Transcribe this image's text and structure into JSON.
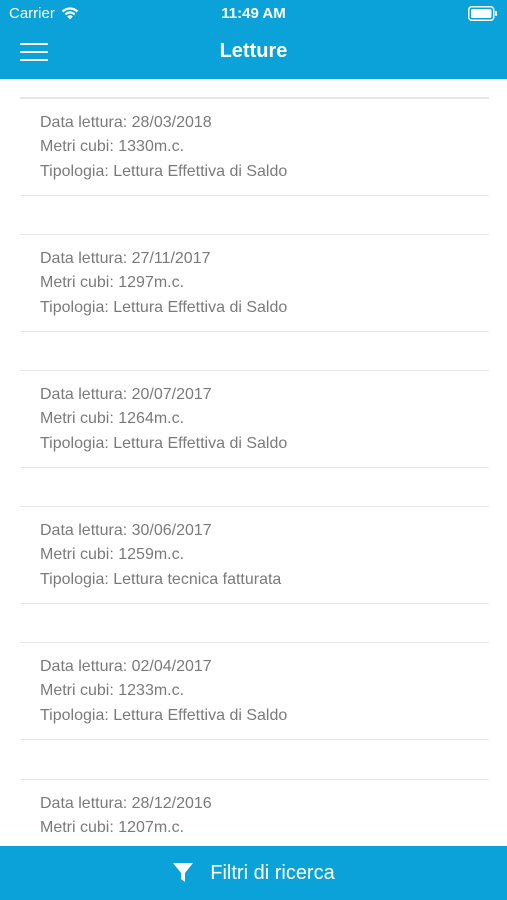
{
  "status_bar": {
    "carrier": "Carrier",
    "time": "11:49 AM"
  },
  "nav": {
    "title": "Letture",
    "menu_icon": "hamburger-menu-icon"
  },
  "readings": [
    {
      "date_label": "Data lettura: 28/03/2018",
      "volume_label": "Metri cubi: 1330m.c.",
      "type_label": "Tipologia: Lettura Effettiva di Saldo"
    },
    {
      "date_label": "Data lettura: 27/11/2017",
      "volume_label": "Metri cubi: 1297m.c.",
      "type_label": "Tipologia: Lettura Effettiva di Saldo"
    },
    {
      "date_label": "Data lettura: 20/07/2017",
      "volume_label": "Metri cubi: 1264m.c.",
      "type_label": "Tipologia: Lettura Effettiva di Saldo"
    },
    {
      "date_label": "Data lettura: 30/06/2017",
      "volume_label": "Metri cubi: 1259m.c.",
      "type_label": "Tipologia: Lettura tecnica fatturata"
    },
    {
      "date_label": "Data lettura: 02/04/2017",
      "volume_label": "Metri cubi: 1233m.c.",
      "type_label": "Tipologia: Lettura Effettiva di Saldo"
    },
    {
      "date_label": "Data lettura: 28/12/2016",
      "volume_label": "Metri cubi: 1207m.c.",
      "type_label": ""
    }
  ],
  "footer": {
    "filter_label": "Filtri di ricerca",
    "filter_icon": "funnel-filter-icon"
  },
  "colors": {
    "primary": "#0aa2d8",
    "text_muted": "#7a7a7a",
    "separator": "#e6e6e6"
  }
}
